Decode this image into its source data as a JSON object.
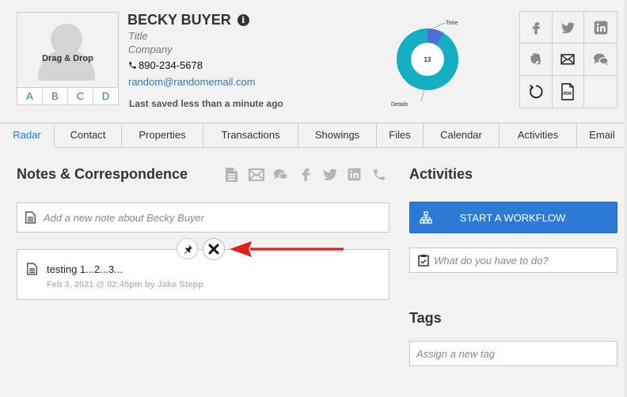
{
  "contact": {
    "name": "BECKY BUYER",
    "title": "Title",
    "company": "Company",
    "phone": "890-234-5678",
    "email": "random@randomemail.com",
    "last_saved": "Last saved less than a minute ago"
  },
  "avatar": {
    "label": "Drag & Drop",
    "grades": [
      "A",
      "B",
      "C",
      "D"
    ]
  },
  "donut_chart": {
    "center_label": "13",
    "labels": [
      "Time",
      "Details"
    ],
    "colors": {
      "time": "#4f6fd8",
      "details": "#13b0c3"
    }
  },
  "social_icons": [
    "facebook-icon",
    "twitter-icon",
    "linkedin-icon",
    "evernote-icon",
    "email-icon",
    "chat-icon",
    "undo-icon",
    "pdf-icon"
  ],
  "tabs": [
    "Radar",
    "Contact",
    "Properties",
    "Transactions",
    "Showings",
    "Files",
    "Calendar",
    "Activities",
    "Email"
  ],
  "active_tab": "Radar",
  "notes": {
    "title": "Notes & Correspondence",
    "input_placeholder": "Add a new note about Becky Buyer",
    "items": [
      {
        "text": "testing 1...2...3...",
        "meta": "Feb 3, 2021 @ 02:45pm by Jake Stepp"
      }
    ]
  },
  "activities": {
    "title": "Activities",
    "workflow_button": "START A WORKFLOW",
    "todo_placeholder": "What do you have to do?"
  },
  "tags": {
    "title": "Tags",
    "placeholder": "Assign a new tag"
  },
  "colors": {
    "link": "#2a7ac0",
    "primary_button": "#2b7bd5",
    "arrow": "#e81c1c",
    "icon_gray": "#9a9a9a"
  }
}
